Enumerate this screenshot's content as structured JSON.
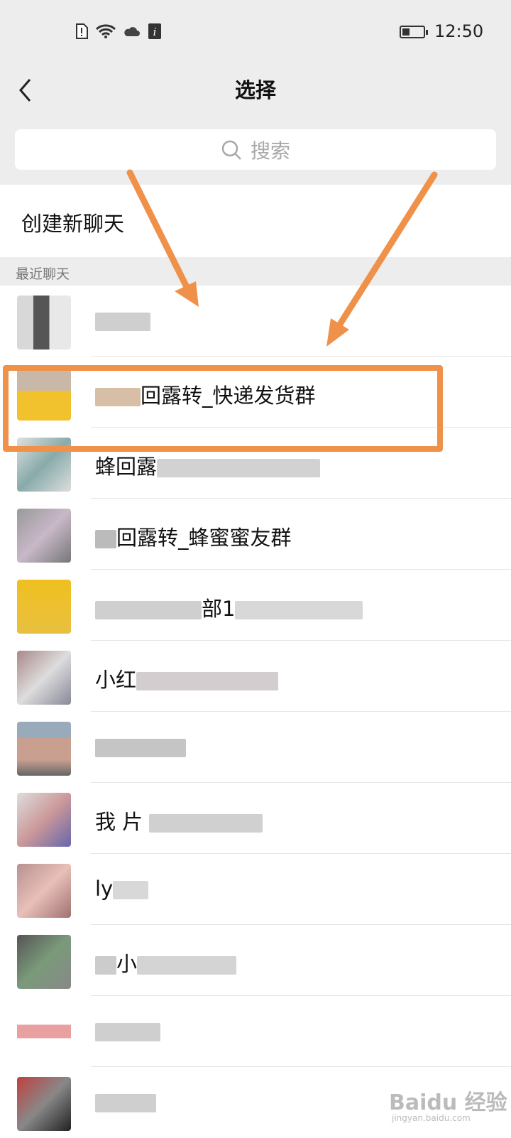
{
  "status_bar": {
    "time": "12:50",
    "icons": [
      "sim-alert-icon",
      "wifi-icon",
      "cloud-icon",
      "info-icon"
    ],
    "battery_level": 0.35
  },
  "header": {
    "title": "选择",
    "back_icon": "chevron-left-icon"
  },
  "search": {
    "placeholder": "搜索",
    "icon": "search-icon"
  },
  "create_new_chat": {
    "label": "创建新聊天"
  },
  "section": {
    "label": "最近聊天"
  },
  "chats": [
    {
      "name": ""
    },
    {
      "name": "回露转_快递发货群"
    },
    {
      "name": "蜂回露"
    },
    {
      "name": "回露转_蜂蜜蜜友群"
    },
    {
      "name": "部1"
    },
    {
      "name": "小红"
    },
    {
      "name": ""
    },
    {
      "name": "我 片"
    },
    {
      "name": "ly"
    },
    {
      "name": "小"
    },
    {
      "name": ""
    },
    {
      "name": ""
    }
  ],
  "highlight_color": "#f0914a",
  "watermark": {
    "text": "Baidu 经验",
    "url": "jingyan.baidu.com"
  }
}
